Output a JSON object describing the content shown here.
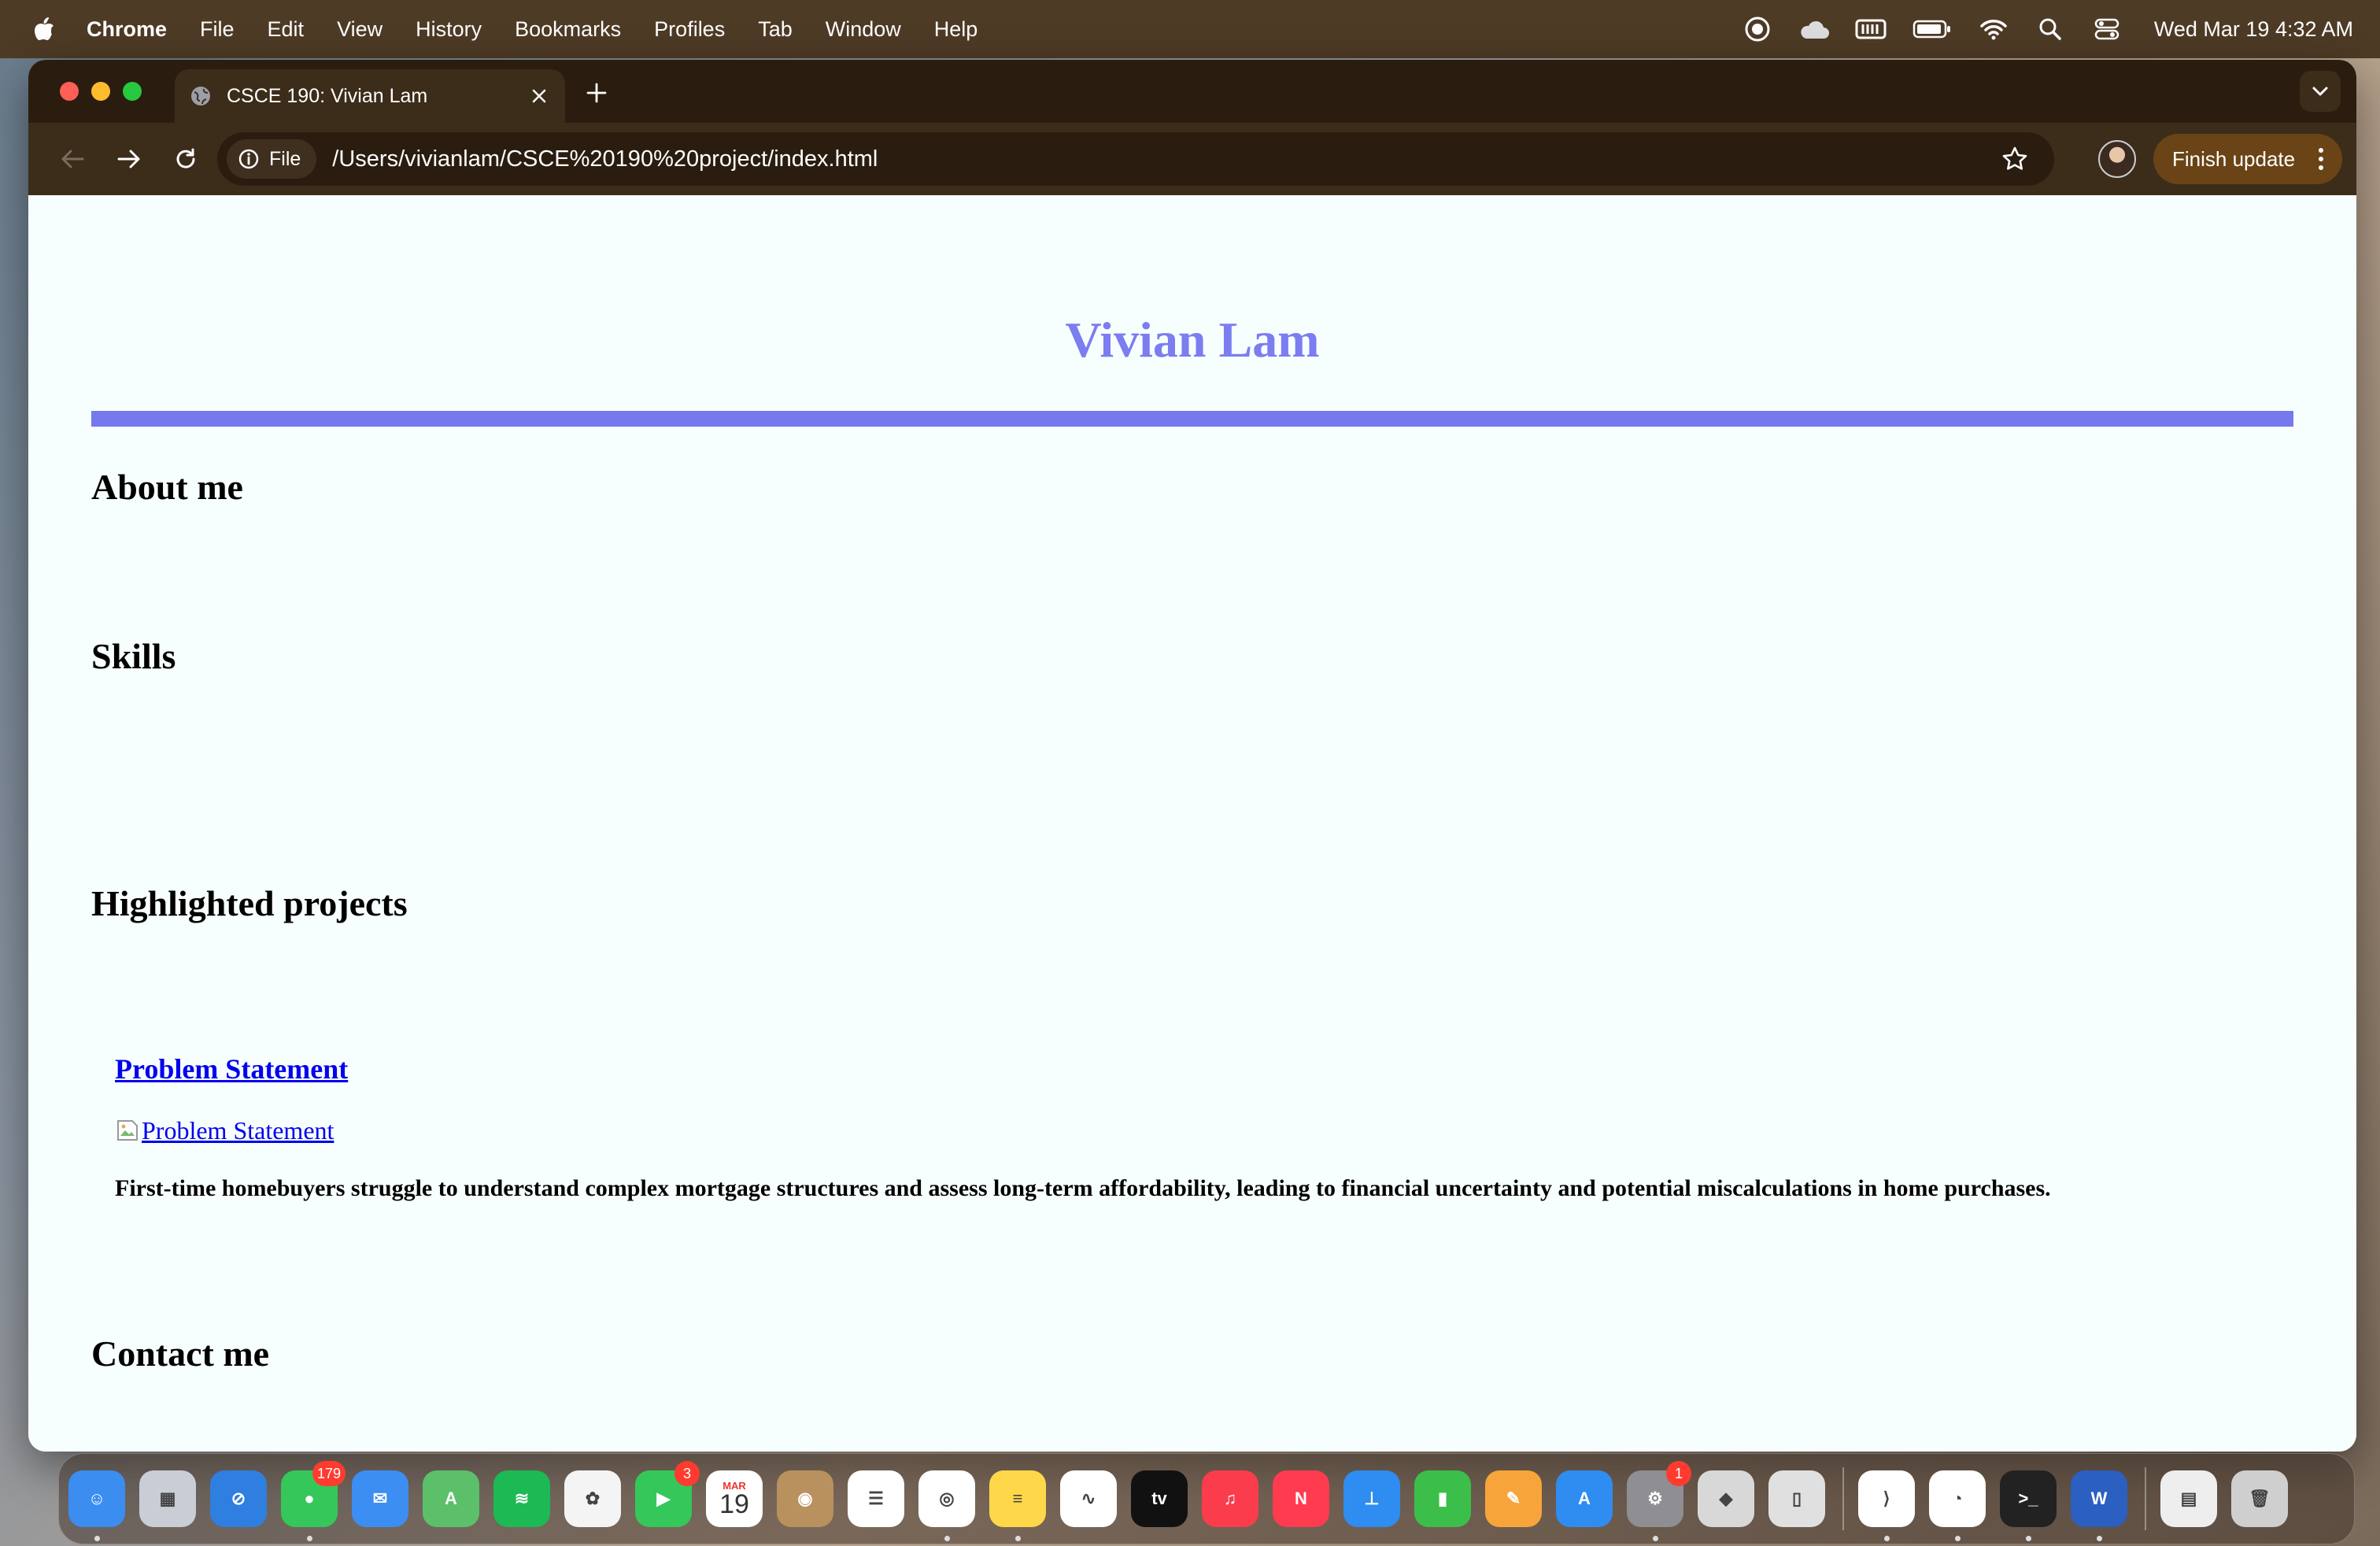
{
  "menubar": {
    "items": [
      "Chrome",
      "File",
      "Edit",
      "View",
      "History",
      "Bookmarks",
      "Profiles",
      "Tab",
      "Window",
      "Help"
    ],
    "status_icons": [
      "focus-icon",
      "cloud-icon",
      "memory-icon",
      "battery-icon",
      "wifi-icon",
      "spotlight-icon",
      "control-center-icon"
    ],
    "clock": "Wed Mar 19  4:32 AM"
  },
  "browser": {
    "tab_title": "CSCE 190: Vivian Lam",
    "file_chip": "File",
    "url": "/Users/vivianlam/CSCE%20190%20project/index.html",
    "finish_update": "Finish update"
  },
  "page": {
    "title": "Vivian Lam",
    "accent_color": "#7678ee",
    "sections": {
      "about": "About me",
      "skills": "Skills",
      "projects": "Highlighted projects",
      "contact": "Contact me"
    },
    "project": {
      "link_text": "Problem Statement",
      "image_alt": "Problem Statement",
      "description": "First-time homebuyers struggle to understand complex mortgage structures and assess long-term affordability, leading to financial uncertainty and potential miscalculations in home purchases."
    }
  },
  "dock": {
    "apps": [
      {
        "name": "finder",
        "color": "#3b8df0",
        "glyph": "☺",
        "running": true
      },
      {
        "name": "launchpad",
        "color": "#c9cdd6",
        "glyph": "▦"
      },
      {
        "name": "safari",
        "color": "#2f7fe0",
        "glyph": "⊘"
      },
      {
        "name": "messages",
        "color": "#35c759",
        "glyph": "●",
        "badge": "179",
        "running": true
      },
      {
        "name": "mail",
        "color": "#3d8ef2",
        "glyph": "✉"
      },
      {
        "name": "maps",
        "color": "#5cbf6a",
        "glyph": "A"
      },
      {
        "name": "spotify",
        "color": "#1db954",
        "glyph": "≋"
      },
      {
        "name": "photos",
        "color": "#f4f4f4",
        "glyph": "✿"
      },
      {
        "name": "facetime",
        "color": "#35c759",
        "glyph": "▶",
        "badge": "3"
      },
      {
        "name": "calendar",
        "color": "#ffffff",
        "glyph": "19",
        "month": "MAR"
      },
      {
        "name": "contacts",
        "color": "#b8915e",
        "glyph": "◉"
      },
      {
        "name": "reminders",
        "color": "#ffffff",
        "glyph": "☰"
      },
      {
        "name": "chrome",
        "color": "#ffffff",
        "glyph": "◎",
        "running": true
      },
      {
        "name": "notes",
        "color": "#ffd84a",
        "glyph": "≡",
        "running": true
      },
      {
        "name": "freeform",
        "color": "#ffffff",
        "glyph": "∿"
      },
      {
        "name": "apple-tv",
        "color": "#111111",
        "glyph": "tv"
      },
      {
        "name": "music",
        "color": "#fa3c4c",
        "glyph": "♫"
      },
      {
        "name": "news",
        "color": "#ff3b4f",
        "glyph": "N"
      },
      {
        "name": "keynote",
        "color": "#2f8cf0",
        "glyph": "⊥"
      },
      {
        "name": "numbers",
        "color": "#3cbf4a",
        "glyph": "▮"
      },
      {
        "name": "pages",
        "color": "#f7a53a",
        "glyph": "✎"
      },
      {
        "name": "app-store",
        "color": "#2f8cf0",
        "glyph": "A"
      },
      {
        "name": "system-settings",
        "color": "#8e8e93",
        "glyph": "⚙",
        "badge": "1",
        "running": true
      },
      {
        "name": "roblox",
        "color": "#d8d8d8",
        "glyph": "◆"
      },
      {
        "name": "iphone-mirroring",
        "color": "#e0e0e0",
        "glyph": "▯"
      },
      {
        "name": "vscode",
        "color": "#ffffff",
        "glyph": "⟩",
        "running": true,
        "separator_before": true
      },
      {
        "name": "activity-monitor",
        "color": "#ffffff",
        "glyph": "◔",
        "running": true
      },
      {
        "name": "terminal",
        "color": "#222222",
        "glyph": ">_",
        "running": true
      },
      {
        "name": "word",
        "color": "#2b5fc0",
        "glyph": "W",
        "running": true
      },
      {
        "name": "downloads-stack",
        "color": "#eeeeee",
        "glyph": "▤",
        "separator_before": true
      },
      {
        "name": "trash",
        "color": "#cfcfcf",
        "glyph": "🗑"
      }
    ]
  }
}
